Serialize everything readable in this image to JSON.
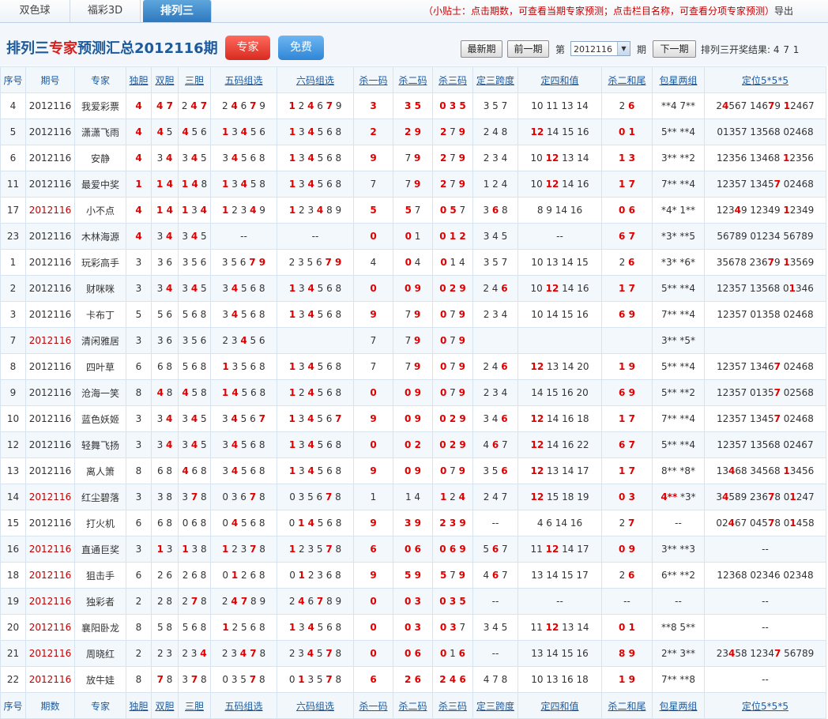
{
  "tabs": [
    "双色球",
    "福彩3D",
    "排列三"
  ],
  "tip": "（小贴士：点击期数，可查看当期专家预测；点击栏目名称，可查看分项专家预测）",
  "exit": "导出",
  "header": {
    "title_a": "排列三",
    "title_b": "专家",
    "title_c": "预测汇总2012116期",
    "btn_expert": "专家",
    "btn_free": "免费",
    "latest": "最新期",
    "prev": "前一期",
    "di": "第",
    "period": "2012116",
    "qi": "期",
    "next": "下一期",
    "result_label": "排列三开奖结果:",
    "result": "4 7 1"
  },
  "columns": [
    "序号",
    "期号",
    "专家",
    "独胆",
    "双胆",
    "三胆",
    "五码组选",
    "六码组选",
    "杀一码",
    "杀二码",
    "杀三码",
    "定三跨度",
    "定四和值",
    "杀二和尾",
    "包星两组",
    "定位5*5*5"
  ],
  "footer_columns": [
    "序号",
    "期数",
    "专家",
    "独胆",
    "双胆",
    "三胆",
    "五码组选",
    "六码组选",
    "杀一码",
    "杀二码",
    "杀三码",
    "定三跨度",
    "定四和值",
    "杀二和尾",
    "包星两组",
    "定位5*5*5"
  ],
  "rows": [
    [
      "4",
      "2012116",
      "我爱彩票",
      "[4]",
      "[4 7]",
      "2 [4 7]",
      "2 [4] 6 [7] 9",
      "[1] 2 [4] 6 [7] 9",
      "[3]",
      "[3 5]",
      "[0 3 5]",
      "3 5 7",
      "10 11 13 14",
      "2 [6]",
      "**4 7**",
      "2[4]567 146[7]9 [1]2467"
    ],
    [
      "5",
      "2012116",
      "潇潇飞雨",
      "[4]",
      "[4] 5",
      "[4] 5 6",
      "[1] 3 [4] 5 6",
      "[1] 3 [4] 5 6 8",
      "[2]",
      "[2 9]",
      "[2] 7 [9]",
      "2 4 8",
      "[12] 14 15 16",
      "[0 1]",
      "5** **4",
      "01357 13568 02468"
    ],
    [
      "6",
      "2012116",
      "安静",
      "[4]",
      "3 [4]",
      "3 [4] 5",
      "3 [4] 5 6 8",
      "[1] 3 [4] 5 6 8",
      "[9]",
      "7 [9]",
      "[2] 7 [9]",
      "2 3 4",
      "10 [12] 13 14",
      "[1 3]",
      "3** **2",
      "12356 13468 [1]2356"
    ],
    [
      "11",
      "2012116",
      "最爱中奖",
      "[1]",
      "[1 4]",
      "[1 4] 8",
      "[1] 3 [4] 5 8",
      "[1] 3 [4] 5 6 8",
      "7",
      "7 [9]",
      "[2] 7 [9]",
      "1 2 4",
      "10 [12] 14 16",
      "[1 7]",
      "7** **4",
      "12357 1345[7] 02468"
    ],
    [
      "17",
      "2012116",
      "小不点",
      "[4]",
      "[1 4]",
      "[1] 3 [4]",
      "[1] 2 3 [4] 9",
      "[1] 2 3 [4] 8 9",
      "[5]",
      "[5] 7",
      "[0 5] 7",
      "3 [6] 8",
      "8 9 14 16",
      "[0 6]",
      "*4* 1**",
      "123[4]9 12349 [1]2349"
    ],
    [
      "23",
      "2012116",
      "木林海源",
      "[4]",
      "3 [4]",
      "3 [4] 5",
      "--",
      "--",
      "[0]",
      "[0] 1",
      "[0 1 2]",
      "3 4 5",
      "--",
      "[6 7]",
      "*3* **5",
      "56789 01234 56789"
    ],
    [
      "1",
      "2012116",
      "玩彩高手",
      "3",
      "3 6",
      "3 5 6",
      "3 5 6 [7 9]",
      "2 3 5 6 [7 9]",
      "4",
      "[0] 4",
      "[0] 1 4",
      "3 5 7",
      "10 13 14 15",
      "2 [6]",
      "*3* *6*",
      "35678 236[7]9 [1]3569"
    ],
    [
      "2",
      "2012116",
      "财咪咪",
      "3",
      "3 [4]",
      "3 [4] 5",
      "3 [4] 5 6 8",
      "[1] 3 [4] 5 6 8",
      "[0]",
      "[0 9]",
      "[0 2 9]",
      "2 4 [6]",
      "10 [12] 14 16",
      "[1 7]",
      "5** **4",
      "12357 13568 0[1]346"
    ],
    [
      "3",
      "2012116",
      "卡布丁",
      "5",
      "5 6",
      "5 6 8",
      "3 [4] 5 6 8",
      "[1] 3 [4] 5 6 8",
      "[9]",
      "7 [9]",
      "[0] 7 [9]",
      "2 3 4",
      "10 14 15 16",
      "[6 9]",
      "7** **4",
      "12357 01358 02468"
    ],
    [
      "7",
      "2012116",
      "清闲雅居",
      "3",
      "3 6",
      "3 5 6",
      "2 3 [4] 5 6",
      "",
      "7",
      "7 [9]",
      "[0] 7 [9]",
      "",
      "",
      "",
      "3** *5*",
      ""
    ],
    [
      "8",
      "2012116",
      "四叶草",
      "6",
      "6 8",
      "5 6 8",
      "[1] 3 5 6 8",
      "[1] 3 [4] 5 6 8",
      "7",
      "7 [9]",
      "[0] 7 [9]",
      "2 4 [6]",
      "[12] 13 14 20",
      "[1 9]",
      "5** **4",
      "12357 1346[7] 02468"
    ],
    [
      "9",
      "2012116",
      "沧海一笑",
      "8",
      "[4] 8",
      "[4] 5 8",
      "[1 4] 5 6 8",
      "[1] 2 [4] 5 6 8",
      "[0]",
      "[0 9]",
      "[0] 7 [9]",
      "2 3 4",
      "14 15 16 20",
      "[6 9]",
      "5** **2",
      "12357 0135[7] 02568"
    ],
    [
      "10",
      "2012116",
      "蓝色妖姬",
      "3",
      "3 [4]",
      "3 [4] 5",
      "3 [4] 5 6 [7]",
      "[1] 3 [4] 5 6 [7]",
      "[9]",
      "[0 9]",
      "[0 2 9]",
      "3 4 [6]",
      "[12] 14 16 18",
      "[1 7]",
      "7** **4",
      "12357 1345[7] 02468"
    ],
    [
      "12",
      "2012116",
      "轻舞飞扬",
      "3",
      "3 [4]",
      "3 [4] 5",
      "3 [4] 5 6 8",
      "[1] 3 [4] 5 6 8",
      "[0]",
      "[0 2]",
      "[0 2 9]",
      "4 [6] 7",
      "[12] 14 16 22",
      "[6 7]",
      "5** **4",
      "12357 13568 02467"
    ],
    [
      "13",
      "2012116",
      "离人箫",
      "8",
      "6 8",
      "[4] 6 8",
      "3 [4] 5 6 8",
      "[1] 3 [4] 5 6 8",
      "[9]",
      "[0 9]",
      "[0] 7 [9]",
      "3 5 [6]",
      "[12] 13 14 17",
      "[1 7]",
      "8** *8*",
      "13[4]68 34568 [1]3456"
    ],
    [
      "14",
      "2012116",
      "红尘碧落",
      "3",
      "3 8",
      "3 [7] 8",
      "0 3 6 [7] 8",
      "0 3 5 6 [7] 8",
      "1",
      "1 4",
      "[1] 2 [4]",
      "2 4 7",
      "[12] 15 18 19",
      "[0 3]",
      "[4**] *3*",
      "3[4]589 236[7]8 0[1]247"
    ],
    [
      "15",
      "2012116",
      "打火机",
      "6",
      "6 8",
      "0 6 8",
      "0 [4] 5 6 8",
      "0 [1 4] 5 6 8",
      "[9]",
      "[3 9]",
      "[2 3 9]",
      "--",
      "4 6 14 16",
      "2 [7]",
      "--",
      "02[4]67 045[7]8 0[1]458"
    ],
    [
      "16",
      "2012116",
      "直通巨奖",
      "3",
      "[1] 3",
      "[1] 3 8",
      "[1] 2 3 [7] 8",
      "[1] 2 3 5 [7] 8",
      "[6]",
      "[0 6]",
      "[0 6 9]",
      "5 [6] 7",
      "11 [12] 14 17",
      "[0 9]",
      "3** **3",
      "--"
    ],
    [
      "18",
      "2012116",
      "狙击手",
      "6",
      "2 6",
      "2 6 8",
      "0 [1] 2 6 8",
      "0 [1] 2 3 6 8",
      "[9]",
      "[5 9]",
      "[5] 7 [9]",
      "4 [6] 7",
      "13 14 15 17",
      "2 [6]",
      "6** **2",
      "12368 02346 02348"
    ],
    [
      "19",
      "2012116",
      "独彩者",
      "2",
      "2 8",
      "2 [7] 8",
      "2 [4 7] 8 9",
      "2 [4] 6 [7] 8 9",
      "[0]",
      "[0 3]",
      "[0 3 5]",
      "--",
      "--",
      "--",
      "--",
      "--"
    ],
    [
      "20",
      "2012116",
      "襄阳卧龙",
      "8",
      "5 8",
      "5 6 8",
      "[1] 2 5 6 8",
      "[1] 3 [4] 5 6 8",
      "[0]",
      "[0 3]",
      "[0 3] 7",
      "3 4 5",
      "11 [12] 13 14",
      "[0 1]",
      "**8 5**",
      "--"
    ],
    [
      "21",
      "2012116",
      "周晓红",
      "2",
      "2 3",
      "2 3 [4]",
      "2 3 [4 7] 8",
      "2 3 [4] 5 [7] 8",
      "[0]",
      "[0 6]",
      "[0] 1 [6]",
      "--",
      "13 14 15 16",
      "[8 9]",
      "2** 3**",
      "23[4]58 1234[7] 56789"
    ],
    [
      "22",
      "2012116",
      "放牛娃",
      "8",
      "[7] 8",
      "3 [7] 8",
      "0 3 5 [7] 8",
      "0 [1] 3 5 [7] 8",
      "[6]",
      "[2 6]",
      "[2 4 6]",
      "4 7 8",
      "10 13 16 18",
      "[1 9]",
      "7** **8",
      "--"
    ]
  ],
  "red_period_rows": [
    4,
    9,
    15,
    17,
    18,
    19,
    20,
    21,
    22
  ],
  "colors": {
    "red": "#e00000",
    "header_blue": "#1b5aa0",
    "stripe": "#f3f8fd"
  }
}
